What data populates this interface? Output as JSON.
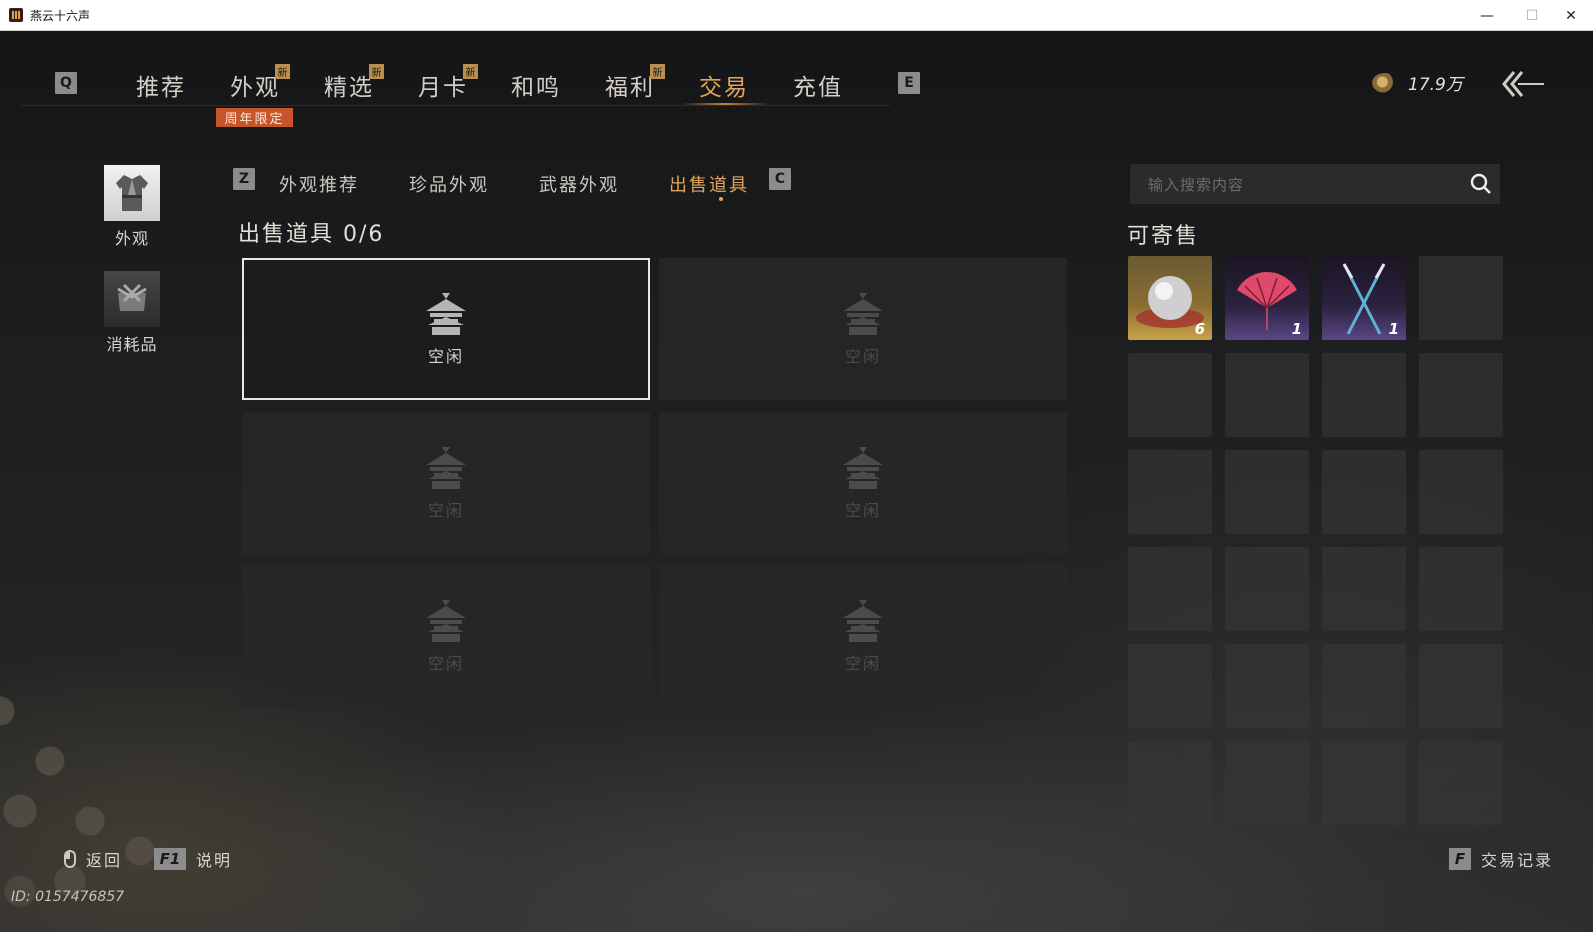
{
  "window": {
    "title": "燕云十六声",
    "controls": {
      "minimize": "—",
      "maximize": "☐",
      "close": "✕"
    }
  },
  "topnav": {
    "key_left": "Q",
    "key_right": "E",
    "tabs": [
      {
        "label": "推荐",
        "new": false,
        "active": false
      },
      {
        "label": "外观",
        "new": true,
        "active": false
      },
      {
        "label": "精选",
        "new": true,
        "active": false
      },
      {
        "label": "月卡",
        "new": true,
        "active": false
      },
      {
        "label": "和鸣",
        "new": false,
        "active": false
      },
      {
        "label": "福利",
        "new": true,
        "active": false
      },
      {
        "label": "交易",
        "new": false,
        "active": true
      },
      {
        "label": "充值",
        "new": false,
        "active": false
      }
    ],
    "new_badge": "新",
    "anniversary_badge": "周年限定",
    "currency": {
      "icon": "coin-icon",
      "value": "17.9万"
    },
    "back_icon": "back-arrow-icon"
  },
  "sidebar": {
    "items": [
      {
        "label": "外观",
        "icon": "robe-icon",
        "active": true
      },
      {
        "label": "消耗品",
        "icon": "bundle-icon",
        "active": false
      }
    ]
  },
  "subtabs": {
    "key_left": "Z",
    "key_right": "C",
    "items": [
      {
        "label": "外观推荐",
        "active": false
      },
      {
        "label": "珍品外观",
        "active": false
      },
      {
        "label": "武器外观",
        "active": false
      },
      {
        "label": "出售道具",
        "active": true
      }
    ]
  },
  "sell": {
    "title": "出售道具 0/6",
    "slots": [
      {
        "label": "空闲",
        "selected": true
      },
      {
        "label": "空闲",
        "selected": false
      },
      {
        "label": "空闲",
        "selected": false
      },
      {
        "label": "空闲",
        "selected": false
      },
      {
        "label": "空闲",
        "selected": false
      },
      {
        "label": "空闲",
        "selected": false
      }
    ]
  },
  "consign": {
    "search_placeholder": "输入搜索内容",
    "title": "可寄售",
    "items": [
      {
        "icon": "pearl-icon",
        "count": "6",
        "rarity": "gold"
      },
      {
        "icon": "fan-icon",
        "count": "1",
        "rarity": "purple"
      },
      {
        "icon": "crossed-swords-icon",
        "count": "1",
        "rarity": "purple"
      }
    ]
  },
  "footer": {
    "back_label": "返回",
    "help_key": "F1",
    "help_label": "说明",
    "record_key": "F",
    "record_label": "交易记录",
    "player_id": "ID: 0157476857"
  },
  "colors": {
    "accent": "#e4a45a",
    "badge_new": "#b98e4f",
    "badge_anniv": "#c5562c"
  }
}
